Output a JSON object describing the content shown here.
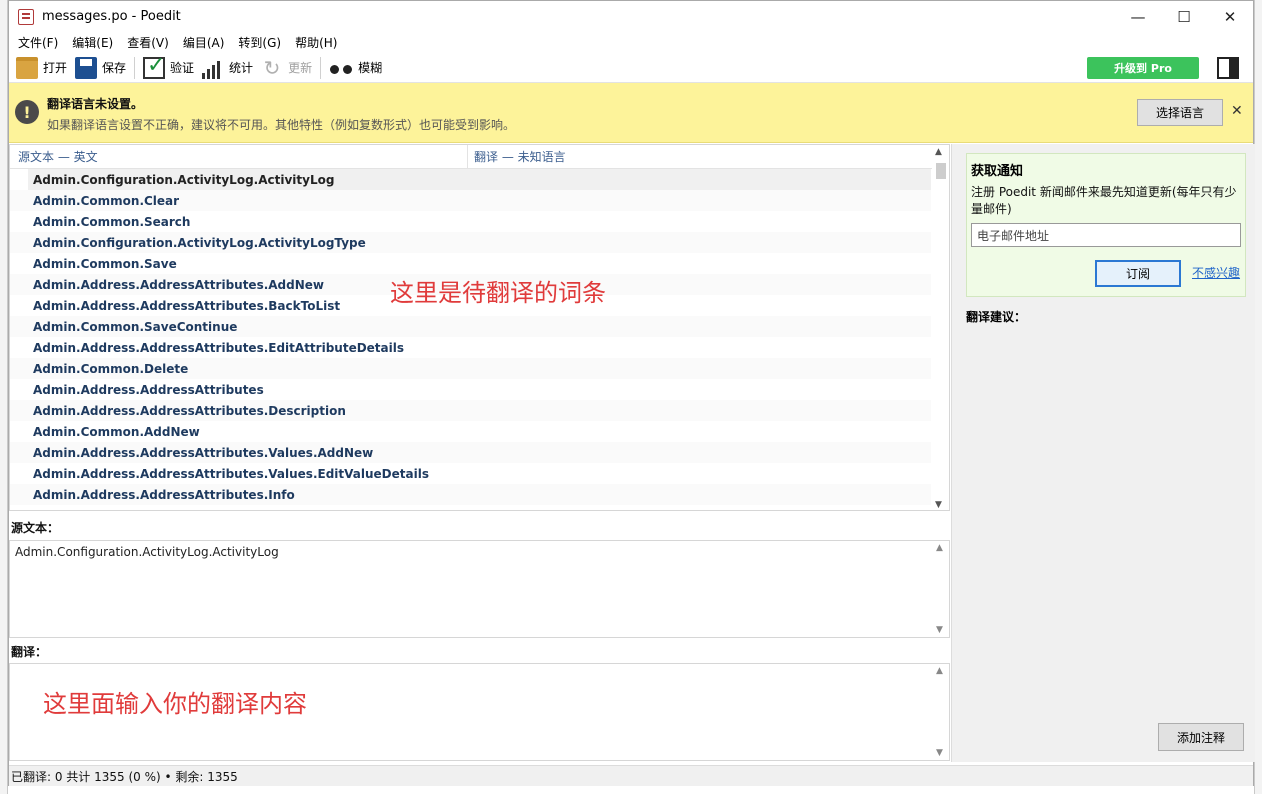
{
  "window": {
    "title": "messages.po - Poedit"
  },
  "menu": [
    "文件(F)",
    "编辑(E)",
    "查看(V)",
    "编目(A)",
    "转到(G)",
    "帮助(H)"
  ],
  "toolbar": {
    "open": "打开",
    "save": "保存",
    "validate": "验证",
    "stats": "统计",
    "update": "更新",
    "fuzzy": "模糊",
    "upgrade": "升级到 Pro"
  },
  "warning": {
    "title": "翻译语言未设置。",
    "description": "如果翻译语言设置不正确，建议将不可用。其他特性（例如复数形式）也可能受到影响。",
    "button": "选择语言"
  },
  "list": {
    "col_source": "源文本 — 英文",
    "col_translation": "翻译 — 未知语言",
    "rows": [
      "Admin.Configuration.ActivityLog.ActivityLog",
      "Admin.Common.Clear",
      "Admin.Common.Search",
      "Admin.Configuration.ActivityLog.ActivityLogType",
      "Admin.Common.Save",
      "Admin.Address.AddressAttributes.AddNew",
      "Admin.Address.AddressAttributes.BackToList",
      "Admin.Common.SaveContinue",
      "Admin.Address.AddressAttributes.EditAttributeDetails",
      "Admin.Common.Delete",
      "Admin.Address.AddressAttributes",
      "Admin.Address.AddressAttributes.Description",
      "Admin.Common.AddNew",
      "Admin.Address.AddressAttributes.Values.AddNew",
      "Admin.Address.AddressAttributes.Values.EditValueDetails",
      "Admin.Address.AddressAttributes.Info"
    ],
    "annotation": "这里是待翻译的词条"
  },
  "source_pane": {
    "label": "源文本：",
    "text": "Admin.Configuration.ActivityLog.ActivityLog"
  },
  "translation_pane": {
    "label": "翻译：",
    "annotation": "这里面输入你的翻译内容"
  },
  "sidebar": {
    "notice_title": "获取通知",
    "notice_desc": "注册 Poedit 新闻邮件来最先知道更新(每年只有少量邮件)",
    "email_placeholder": "电子邮件地址",
    "subscribe": "订阅",
    "not_interested": "不感兴趣",
    "suggestions_label": "翻译建议：",
    "add_comment": "添加注释"
  },
  "status": {
    "text": "已翻译: 0 共计 1355 (0 %)  •  剩余: 1355"
  },
  "colors": {
    "warning_bg": "#fdf39a",
    "pro_button": "#3cc35c",
    "annotation_red": "#e03b3b"
  }
}
